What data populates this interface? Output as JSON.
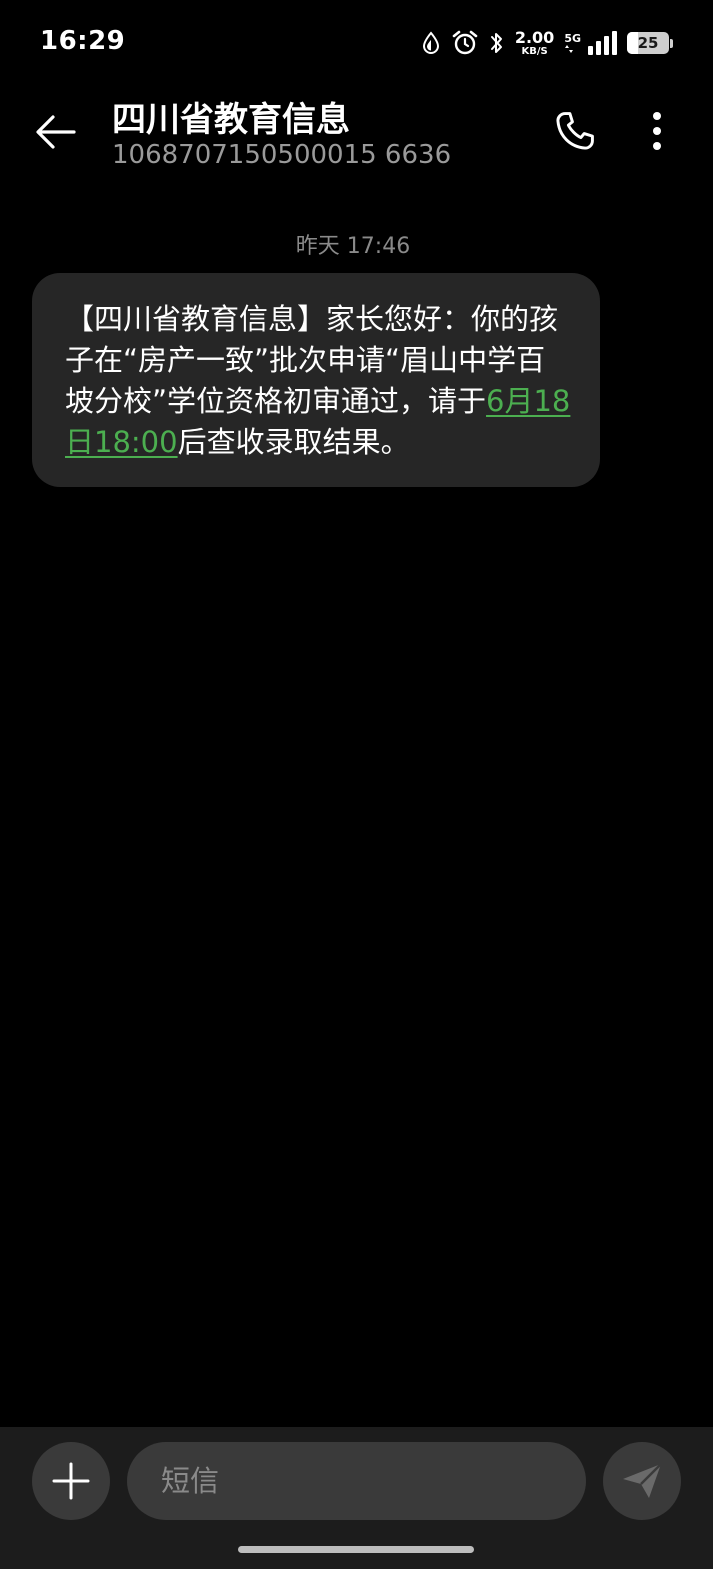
{
  "status_bar": {
    "time": "16:29",
    "network_speed": "2.00",
    "network_speed_unit": "KB/S",
    "network_type": "5G",
    "battery_level": "25",
    "battery_fraction": 0.25,
    "icons": [
      "data-saver-icon",
      "alarm-icon",
      "bluetooth-icon",
      "signal-icon",
      "battery-icon"
    ]
  },
  "header": {
    "contact_name": "四川省教育信息",
    "contact_number": "1068707150500015 6636",
    "icons": {
      "back": "arrow-left-icon",
      "call": "phone-icon",
      "more": "more-vertical-icon"
    }
  },
  "conversation": {
    "timestamp": "昨天 17:46",
    "message": {
      "before_link": "【四川省教育信息】家长您好：你的孩子在“房产一致”批次申请“眉山中学百坡分校”学位资格初审通过，请于",
      "link_text": "6月18日18:00",
      "after_link": "后查收录取结果。"
    }
  },
  "composer": {
    "placeholder": "短信",
    "icons": {
      "add": "plus-icon",
      "send": "send-icon"
    }
  },
  "colors": {
    "background": "#000000",
    "bubble": "#262626",
    "link": "#4caf50",
    "muted_text": "#8a8a8a",
    "composer_bg": "#1c1c1c",
    "control_bg": "#3a3a3a"
  }
}
